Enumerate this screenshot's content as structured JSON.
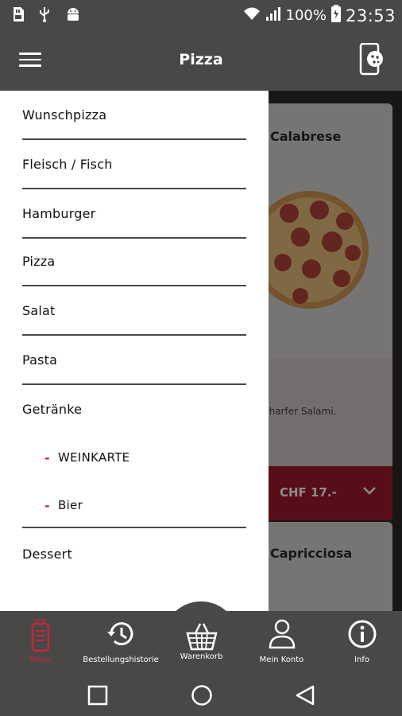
{
  "status_bar": {
    "battery": "100%",
    "time": "23:53",
    "icons": [
      "sd-card-icon",
      "usb-icon",
      "android-icon",
      "wifi-icon",
      "signal-icon",
      "battery-icon"
    ]
  },
  "app_bar": {
    "title": "Pizza",
    "icons": [
      "menu-icon",
      "phone-pizza-icon"
    ]
  },
  "drawer": {
    "items": [
      {
        "label": "Wunschpizza"
      },
      {
        "label": "Fleisch / Fisch"
      },
      {
        "label": "Hamburger"
      },
      {
        "label": "Pizza"
      },
      {
        "label": "Salat"
      },
      {
        "label": "Pasta"
      },
      {
        "label": "Getränke"
      },
      {
        "label": "Dessert"
      }
    ],
    "sub_items": [
      {
        "dash": "-",
        "label": "WEINKARTE"
      },
      {
        "dash": "-",
        "label": "Bier"
      }
    ]
  },
  "background": {
    "card1": {
      "title": "Calabrese",
      "description": "charfer Salami.",
      "price": "CHF 17.-"
    },
    "card2": {
      "title": "Capricciosa"
    }
  },
  "bottom_nav": {
    "items": [
      {
        "label": "Menu",
        "icon": "menu-bottle-icon"
      },
      {
        "label": "Bestellungshistorie",
        "icon": "history-icon"
      },
      {
        "label": "Warenkorb",
        "icon": "basket-icon"
      },
      {
        "label": "Mein Konto",
        "icon": "user-icon"
      },
      {
        "label": "Info",
        "icon": "info-icon"
      }
    ],
    "active_color": "#c2283b"
  },
  "system_nav": {
    "icons": [
      "recents-icon",
      "home-icon",
      "back-icon"
    ]
  },
  "colors": {
    "bar": "#4a4846",
    "accent": "#9e1b2c",
    "drawer_bg": "#ffffff"
  }
}
